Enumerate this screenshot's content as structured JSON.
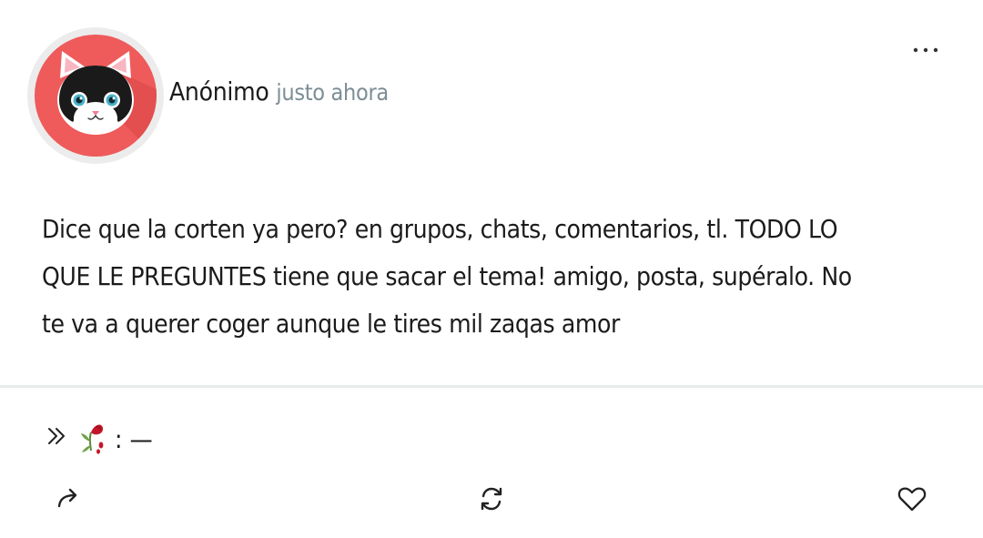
{
  "post": {
    "author": "Anónimo",
    "timestamp": "justo ahora",
    "avatar_icon": "cat-face-icon",
    "avatar_bg_color": "#ef5a5a",
    "menu_icon": "more-horizontal-icon",
    "lines": [
      "Dice que la corten ya pero? en grupos, chats, comentarios, tl. TODO LO",
      "QUE LE PREGUNTES tiene que sacar el tema! amigo, posta, supéralo. No",
      "te va a querer coger aunque le tires mil zaqas amor"
    ]
  },
  "reply": {
    "separator": ": —",
    "icons": [
      "double-chevron-right-icon",
      "wilted-rose-icon"
    ]
  },
  "actions": {
    "share_icon": "share-arrow-icon",
    "refresh_icon": "refresh-icon",
    "like_icon": "heart-icon"
  }
}
